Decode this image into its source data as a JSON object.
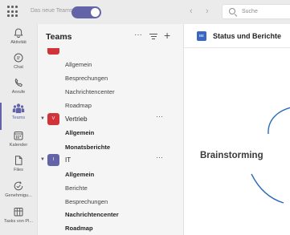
{
  "titlebar": {
    "new_teams_label": "Das neue Teams",
    "search_placeholder": "Suche"
  },
  "rail": {
    "items": [
      {
        "label": "Aktivität",
        "icon": "bell-icon"
      },
      {
        "label": "Chat",
        "icon": "chat-icon"
      },
      {
        "label": "Anrufe",
        "icon": "phone-icon"
      },
      {
        "label": "Teams",
        "icon": "teams-icon",
        "active": true
      },
      {
        "label": "Kalender",
        "icon": "calendar-icon"
      },
      {
        "label": "Files",
        "icon": "file-icon"
      },
      {
        "label": "Genehmigu...",
        "icon": "approvals-icon"
      },
      {
        "label": "Tasks von Pl...",
        "icon": "tasks-icon"
      }
    ]
  },
  "panel": {
    "title": "Teams",
    "more_label": "···",
    "add_label": "+"
  },
  "teams": [
    {
      "channels": [
        "Allgemein",
        "Besprechungen",
        "Nachrichtencenter",
        "Roadmap"
      ]
    },
    {
      "name": "Vertrieb",
      "initial": "V",
      "more": "···",
      "channels": [
        {
          "label": "Allgemein",
          "bold": true
        },
        {
          "label": "Monatsberichte",
          "bold": true
        }
      ]
    },
    {
      "name": "IT",
      "initial": "I",
      "more": "···",
      "channels": [
        {
          "label": "Allgemein",
          "bold": true
        },
        {
          "label": "Berichte",
          "bold": false
        },
        {
          "label": "Besprechungen",
          "bold": false
        },
        {
          "label": "Nachrichtencenter",
          "bold": true
        },
        {
          "label": "Roadmap",
          "bold": true
        }
      ]
    }
  ],
  "main": {
    "channel_badge": "BE",
    "title": "Status und Berichte",
    "canvas_text": "Brainstorming"
  },
  "colors": {
    "accent": "#6264a7",
    "team_vertrieb": "#d13438",
    "team_it": "#6264a7",
    "channel_badge": "#3a67c4"
  }
}
